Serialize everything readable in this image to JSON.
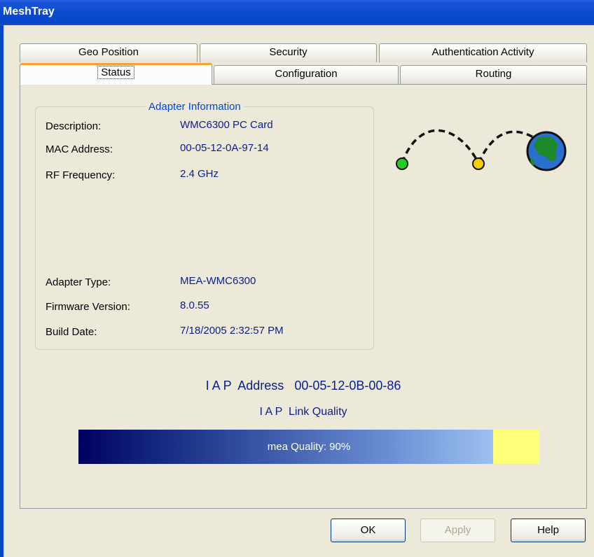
{
  "window": {
    "title": "MeshTray"
  },
  "tabs": {
    "row1": [
      "Geo Position",
      "Security",
      "Authentication Activity"
    ],
    "row2": [
      "Status",
      "Configuration",
      "Routing"
    ],
    "selected": "Status"
  },
  "adapter_info": {
    "legend": "Adapter Information",
    "rows": [
      {
        "label": "Description:",
        "value": "WMC6300 PC Card"
      },
      {
        "label": "MAC Address:",
        "value": "00-05-12-0A-97-14"
      },
      {
        "label": "RF Frequency:",
        "value": "2.4 GHz"
      },
      {
        "label": "Adapter Type:",
        "value": "MEA-WMC6300"
      },
      {
        "label": "Firmware Version:",
        "value": "8.0.55"
      },
      {
        "label": "Build Date:",
        "value": "7/18/2005 2:32:57 PM"
      }
    ]
  },
  "iap": {
    "address_label": "I A P  Address",
    "address_value": "00-05-12-0B-00-86",
    "link_quality_label": "I A P  Link Quality"
  },
  "quality_bar": {
    "text": "mea Quality: 90%",
    "value": 90
  },
  "graphic": {
    "icons": [
      "green-node-icon",
      "yellow-node-icon",
      "globe-icon"
    ],
    "colors": {
      "node1": "#22cc22",
      "node2": "#f5d000",
      "globe_ocean": "#2a6fd0",
      "globe_land": "#1a8a2a"
    }
  },
  "buttons": {
    "ok": "OK",
    "apply": "Apply",
    "help": "Help"
  },
  "colors": {
    "title_bar": "#0a46c8",
    "dialog_bg": "#ece9d8",
    "value_text": "#0a1e8c",
    "legend_text": "#0046d5"
  }
}
